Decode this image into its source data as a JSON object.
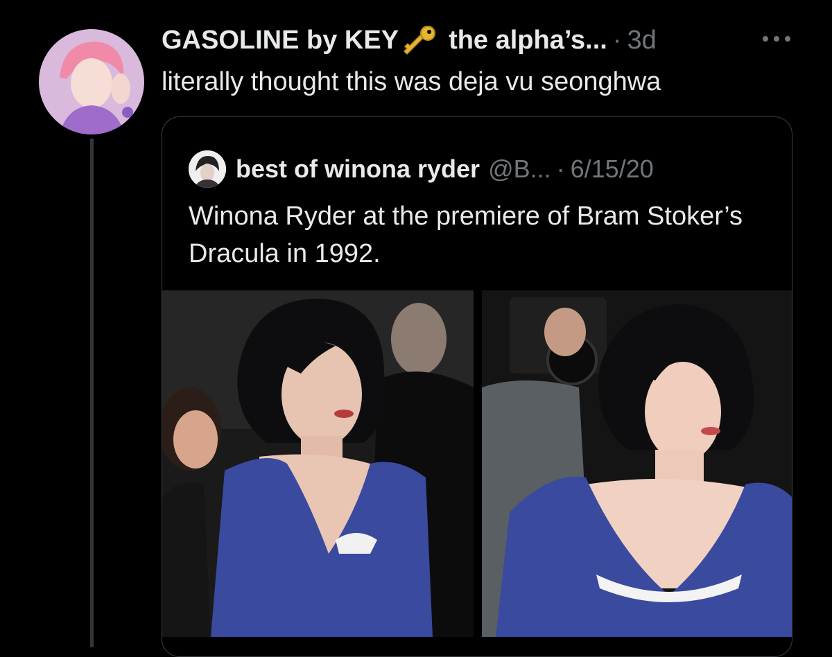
{
  "tweet": {
    "author_name": "GASOLINE by KEY",
    "author_handle": "the alpha’s...",
    "separator": "·",
    "time": "3d",
    "text": "literally thought this was deja vu seonghwa",
    "icons": {
      "more": "more-icon",
      "key": "key-icon"
    }
  },
  "quote": {
    "author_name": "best of winona ryder",
    "author_handle": "@B...",
    "separator": "·",
    "date": "6/15/20",
    "text": "Winona Ryder at the premiere of Bram Stoker’s Dracula in 1992."
  },
  "colors": {
    "background": "#000000",
    "primary_text": "#e7e9ea",
    "secondary_text": "#71767b",
    "border": "#3b3f43",
    "dress_blue": "#3a4a9e"
  }
}
